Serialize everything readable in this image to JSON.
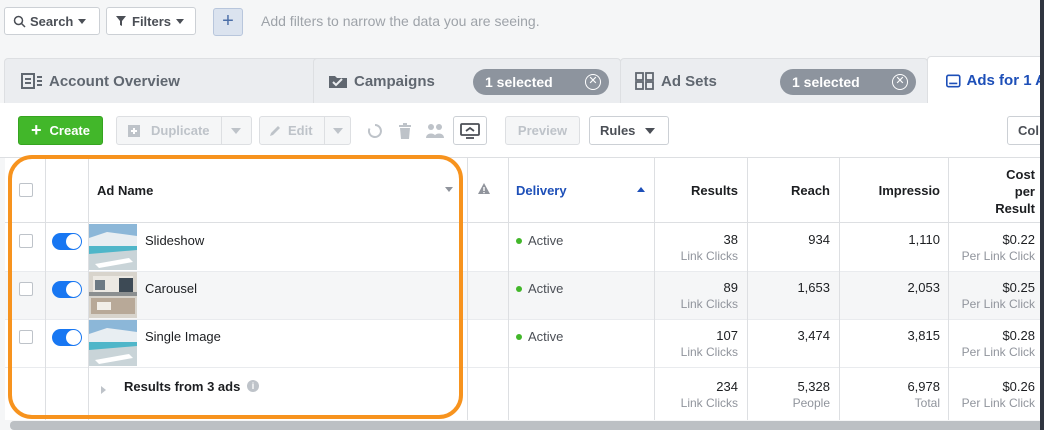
{
  "filterbar": {
    "search_label": "Search",
    "filters_label": "Filters",
    "add_symbol": "+",
    "hint": "Add filters to narrow the data you are seeing."
  },
  "tabs": [
    {
      "label": "Account Overview",
      "icon": "account-overview-icon"
    },
    {
      "label": "Campaigns",
      "icon": "folder-icon",
      "selected_pill": "1 selected"
    },
    {
      "label": "Ad Sets",
      "icon": "grid-icon",
      "selected_pill": "1 selected"
    },
    {
      "label": "Ads for 1 A",
      "icon": "ad-icon"
    }
  ],
  "toolbar": {
    "create": "Create",
    "duplicate": "Duplicate",
    "edit": "Edit",
    "preview": "Preview",
    "rules": "Rules",
    "columns": "Col"
  },
  "table": {
    "headers": {
      "ad_name": "Ad Name",
      "delivery": "Delivery",
      "results": "Results",
      "reach": "Reach",
      "impressions": "Impressio",
      "cost_line1": "Cost",
      "cost_line2": "per",
      "cost_line3": "Result"
    },
    "rows": [
      {
        "name": "Slideshow",
        "delivery": "Active",
        "results": "38",
        "results_sub": "Link Clicks",
        "reach": "934",
        "impressions": "1,110",
        "cost": "$0.22",
        "cost_sub": "Per Link Click"
      },
      {
        "name": "Carousel",
        "delivery": "Active",
        "results": "89",
        "results_sub": "Link Clicks",
        "reach": "1,653",
        "impressions": "2,053",
        "cost": "$0.25",
        "cost_sub": "Per Link Click"
      },
      {
        "name": "Single Image",
        "delivery": "Active",
        "results": "107",
        "results_sub": "Link Clicks",
        "reach": "3,474",
        "impressions": "3,815",
        "cost": "$0.28",
        "cost_sub": "Per Link Click"
      }
    ],
    "summary": {
      "label": "Results from 3 ads",
      "results": "234",
      "results_sub": "Link Clicks",
      "reach": "5,328",
      "reach_sub": "People",
      "impressions": "6,978",
      "impressions_sub": "Total",
      "cost": "$0.26",
      "cost_sub": "Per Link Click"
    }
  },
  "colors": {
    "accent_blue": "#1d4fb8",
    "create_green": "#42b72a",
    "highlight_orange": "#f7931e",
    "active_dot": "#42b72a"
  }
}
